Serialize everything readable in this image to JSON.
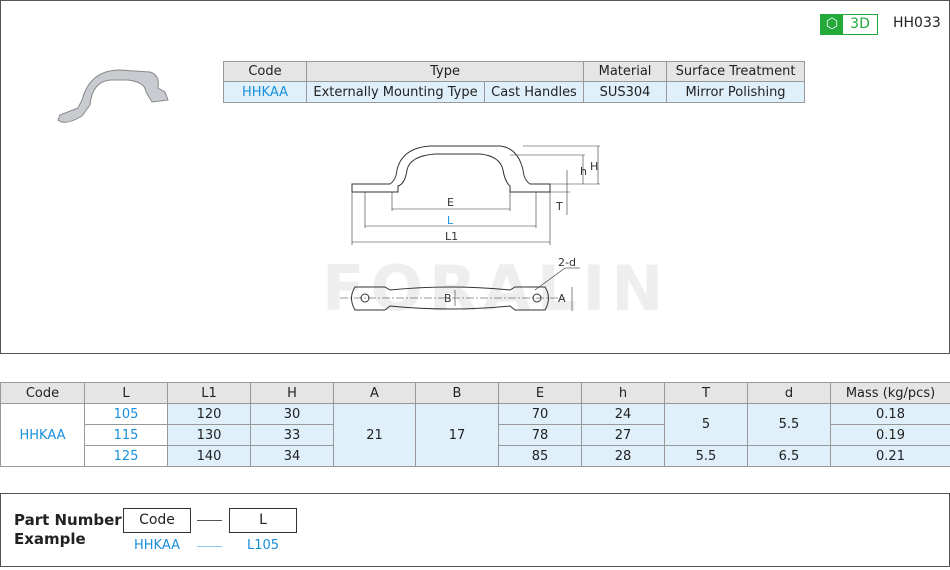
{
  "header": {
    "badge_3d": "3D",
    "part_id": "HH033"
  },
  "top_table": {
    "headers": [
      "Code",
      "Type",
      "Material",
      "Surface Treatment"
    ],
    "row": {
      "code": "HHKAA",
      "type1": "Externally Mounting Type",
      "type2": "Cast Handles",
      "material": "SUS304",
      "surface": "Mirror Polishing"
    }
  },
  "drawing": {
    "labels": {
      "E": "E",
      "L": "L",
      "L1": "L1",
      "h": "h",
      "H": "H",
      "T": "T",
      "B": "B",
      "A": "A",
      "d": "2-d"
    },
    "watermark": "FORALIN"
  },
  "spec_table": {
    "headers": [
      "Code",
      "L",
      "L1",
      "H",
      "A",
      "B",
      "E",
      "h",
      "T",
      "d",
      "Mass (kg/pcs)"
    ],
    "code": "HHKAA",
    "A": "21",
    "B": "17",
    "T_shared": "5",
    "d_shared": "5.5",
    "rows": [
      {
        "L": "105",
        "L1": "120",
        "H": "30",
        "E": "70",
        "h": "24",
        "mass": "0.18"
      },
      {
        "L": "115",
        "L1": "130",
        "H": "33",
        "E": "78",
        "h": "27",
        "mass": "0.19"
      },
      {
        "L": "125",
        "L1": "140",
        "H": "34",
        "E": "85",
        "h": "28",
        "T": "5.5",
        "d": "6.5",
        "mass": "0.21"
      }
    ]
  },
  "part_number": {
    "title_line1": "Part Number",
    "title_line2": "Example",
    "code_label": "Code",
    "l_label": "L",
    "code_example": "HHKAA",
    "l_example": "L105"
  },
  "colors": {
    "accent": "#1a8fdc",
    "green": "#22a93a",
    "light_blue": "#dff0fb"
  }
}
